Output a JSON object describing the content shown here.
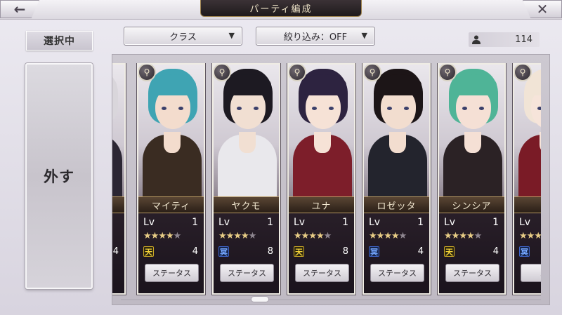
{
  "header": {
    "title": "パーティ編成",
    "back_icon": "left-arrow-icon",
    "close_icon": "close-icon",
    "back_glyph": "←",
    "close_glyph": "✕"
  },
  "sidebar": {
    "selected_label": "選択中",
    "remove_label": "外す"
  },
  "filters": {
    "class_label": "クラス",
    "filter_label": "絞り込み：OFF",
    "arrow_glyph": "▼"
  },
  "unit_count": {
    "icon": "person-icon",
    "value": "114"
  },
  "cards": [
    {
      "name": "",
      "lv_label": "",
      "level": "",
      "rarity": 4,
      "attr": "",
      "attr_color": "",
      "cost": "4",
      "status": "",
      "class_icon": "",
      "hair": "#d9d6db",
      "skin": "#f0dfd6",
      "cloth": "#2b2633",
      "partial": "left"
    },
    {
      "name": "マイティ",
      "lv_label": "Lv",
      "level": "1",
      "rarity": 4,
      "attr": "天",
      "attr_color": "gold",
      "cost": "4",
      "status": "ステータス",
      "class_icon": "staff-icon",
      "hair": "#3fa4b3",
      "skin": "#f3dccd",
      "cloth": "#3a2c22"
    },
    {
      "name": "ヤクモ",
      "lv_label": "Lv",
      "level": "1",
      "rarity": 4,
      "attr": "冥",
      "attr_color": "blue",
      "cost": "8",
      "status": "ステータス",
      "class_icon": "staff-icon",
      "hair": "#1d1a22",
      "skin": "#f1dfd2",
      "cloth": "#e9e8ec"
    },
    {
      "name": "ユナ",
      "lv_label": "Lv",
      "level": "1",
      "rarity": 4,
      "attr": "天",
      "attr_color": "gold",
      "cost": "8",
      "status": "ステータス",
      "class_icon": "scroll-icon",
      "hair": "#2d2340",
      "skin": "#f6e2d6",
      "cloth": "#7d1e2a"
    },
    {
      "name": "ロゼッタ",
      "lv_label": "Lv",
      "level": "1",
      "rarity": 4,
      "attr": "冥",
      "attr_color": "blue",
      "cost": "4",
      "status": "ステータス",
      "class_icon": "scroll-icon",
      "hair": "#1c1517",
      "skin": "#f2ddcf",
      "cloth": "#23242d"
    },
    {
      "name": "シンシア",
      "lv_label": "Lv",
      "level": "1",
      "rarity": 4,
      "attr": "天",
      "attr_color": "gold",
      "cost": "4",
      "status": "ステータス",
      "class_icon": "sword-icon",
      "hair": "#4fb497",
      "skin": "#f5e0d5",
      "cloth": "#2b2225"
    },
    {
      "name": "チ",
      "lv_label": "Lv",
      "level": "1",
      "rarity": 4,
      "attr": "冥",
      "attr_color": "blue",
      "cost": "",
      "status": "ステ",
      "class_icon": "sword-icon",
      "hair": "#f1e4d6",
      "skin": "#f6e4da",
      "cloth": "#7a1b26",
      "partial": "right"
    }
  ]
}
